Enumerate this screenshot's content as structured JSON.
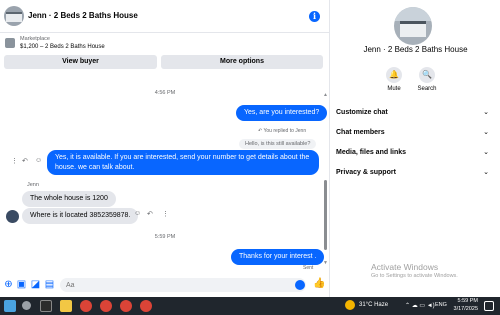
{
  "header": {
    "title": "Jenn · 2 Beds 2 Baths House",
    "info_icon": "info-icon"
  },
  "listing": {
    "source": "Marketplace",
    "price_title": "$1,200 – 2 Beds 2 Baths House"
  },
  "actions": {
    "view_buyer": "View buyer",
    "more_options": "More options"
  },
  "messages": {
    "time1": "4:56 PM",
    "out1": "Yes, are you interested?",
    "replied_note": "↶ You replied to Jenn",
    "reply_quote": "Hello, is this still available?",
    "out2": "Yes, it is available. If you are interested, send your number to get details about the house. we can talk about.",
    "sender_name": "Jenn",
    "in1": "The whole house is 1200",
    "in2": "Where is it located 3852359878.",
    "time2": "5:59 PM",
    "out3": "Thanks for your interest .",
    "status": "Sent"
  },
  "composer": {
    "placeholder": "Aa"
  },
  "details": {
    "title": "Jenn · 2 Beds 2 Baths House",
    "mute_label": "Mute",
    "search_label": "Search",
    "sections": [
      "Customize chat",
      "Chat members",
      "Media, files and links",
      "Privacy & support"
    ]
  },
  "watermark": {
    "title": "Activate Windows",
    "subtitle": "Go to Settings to activate Windows."
  },
  "taskbar": {
    "weather": "31°C  Haze",
    "lang": "ENG",
    "time": "5:59 PM",
    "date": "3/17/2025"
  },
  "colors": {
    "accent": "#0866ff",
    "bubble_in": "#e4e6eb",
    "taskbar": "#20262d"
  }
}
